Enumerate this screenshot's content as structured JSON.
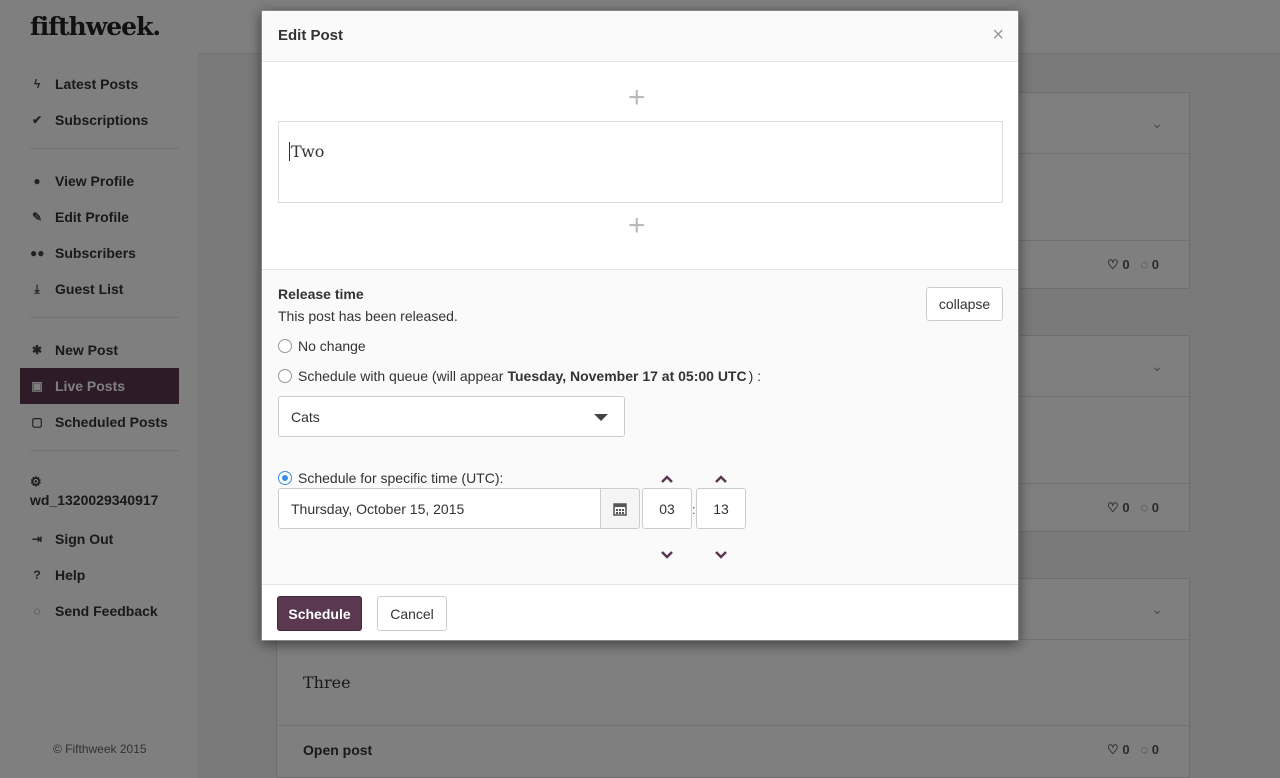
{
  "app": {
    "logo": "fifthweek.",
    "copyright": "© Fifthweek 2015"
  },
  "sidebar": {
    "items": [
      {
        "label": "Latest Posts",
        "icon": "bolt-icon"
      },
      {
        "label": "Subscriptions",
        "icon": "check-circle-icon"
      },
      {
        "label": "View Profile",
        "icon": "user-icon"
      },
      {
        "label": "Edit Profile",
        "icon": "pencil-icon"
      },
      {
        "label": "Subscribers",
        "icon": "users-icon"
      },
      {
        "label": "Guest List",
        "icon": "download-user-icon"
      },
      {
        "label": "New Post",
        "icon": "asterisk-icon"
      },
      {
        "label": "Live Posts",
        "icon": "calendar-check-icon",
        "active": true
      },
      {
        "label": "Scheduled Posts",
        "icon": "calendar-icon"
      },
      {
        "label": "Sign Out",
        "icon": "sign-out-icon"
      },
      {
        "label": "Help",
        "icon": "question-icon"
      },
      {
        "label": "Send Feedback",
        "icon": "comment-icon"
      }
    ],
    "username": "wd_1320029340917"
  },
  "feed": {
    "cards": [
      {
        "likes": "0",
        "comments": "0"
      },
      {
        "likes": "0",
        "comments": "0"
      },
      {
        "text": "Three",
        "open_label": "Open post",
        "likes": "0",
        "comments": "0"
      }
    ]
  },
  "modal": {
    "title": "Edit Post",
    "close": "×",
    "editor_text": "Two",
    "release": {
      "title": "Release time",
      "status": "This post has been released.",
      "collapse_label": "collapse",
      "options": {
        "no_change": "No change",
        "queue_prefix": "Schedule with queue (will appear",
        "queue_time": "Tuesday, November 17 at 05:00 UTC",
        "queue_suffix": ") :",
        "specific": "Schedule for specific time (UTC):"
      },
      "selected_option": "specific",
      "queue_select": "Cats",
      "date": "Thursday, October 15, 2015",
      "hour": "03",
      "minute": "13",
      "colon": ":"
    },
    "buttons": {
      "schedule": "Schedule",
      "cancel": "Cancel"
    }
  },
  "colors": {
    "accent": "#5a3850",
    "radio": "#3b8ede"
  }
}
